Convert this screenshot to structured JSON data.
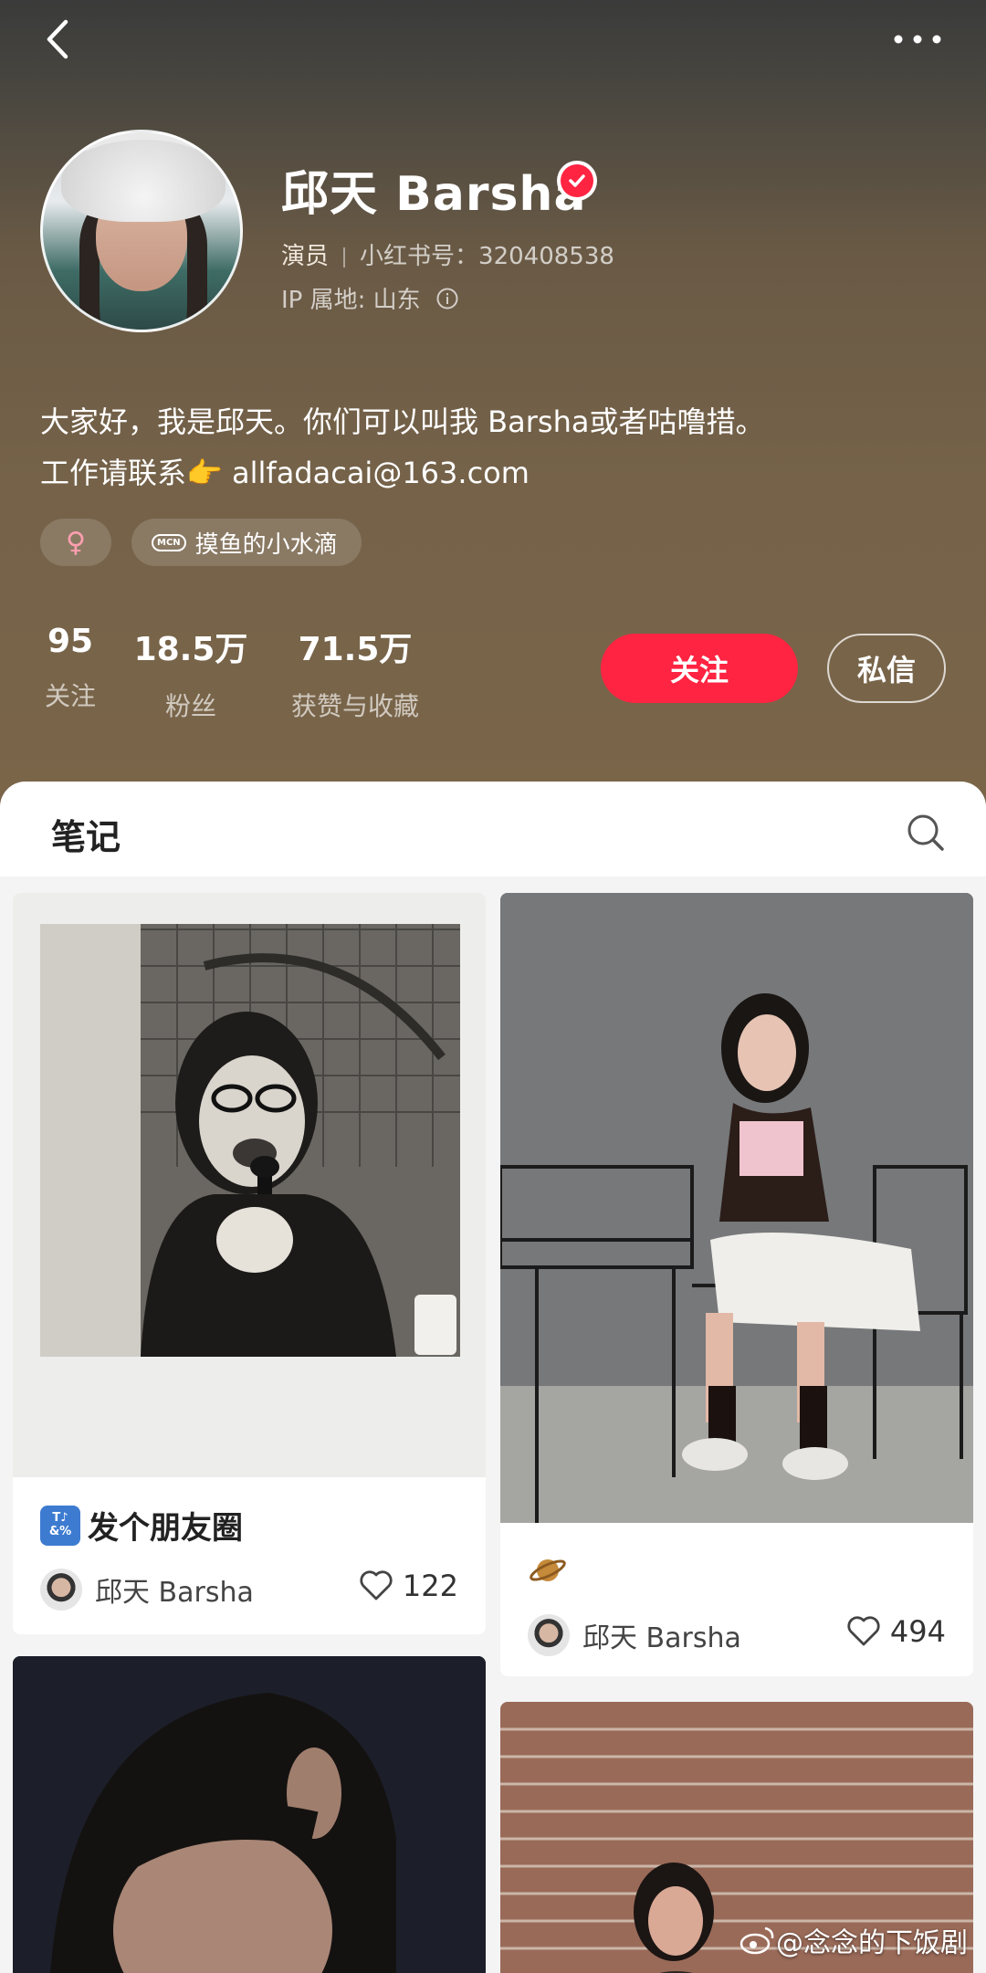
{
  "header": {
    "name": "邱天 Barsha",
    "occupation": "演员",
    "id_label": "小红书号：",
    "id_value": "320408538",
    "ip_label": "IP 属地: 山东",
    "bio_line1": "大家好，我是邱天。你们可以叫我 Barsha或者咕噜措。",
    "bio_line2_prefix": "工作请联系",
    "bio_emoji": "👉",
    "bio_email": "allfadacai@163.com",
    "gender_symbol": "♀",
    "mcn_badge": "MCN",
    "mcn_name": "摸鱼的小水滴"
  },
  "stats": [
    {
      "value": "95",
      "label": "关注"
    },
    {
      "value": "18.5万",
      "label": "粉丝"
    },
    {
      "value": "71.5万",
      "label": "获赞与收藏"
    }
  ],
  "actions": {
    "follow_label": "关注",
    "message_label": "私信"
  },
  "tab": {
    "title": "笔记"
  },
  "notes": [
    {
      "title": "发个朋友圈",
      "title_badge": "🔣",
      "author": "邱天 Barsha",
      "likes": "122"
    },
    {
      "title": "",
      "title_emoji": "🪐",
      "author": "邱天 Barsha",
      "likes": "494"
    }
  ],
  "watermark": "@念念的下饭剧",
  "colors": {
    "accent": "#ff2442",
    "header_bg": "#756249"
  }
}
